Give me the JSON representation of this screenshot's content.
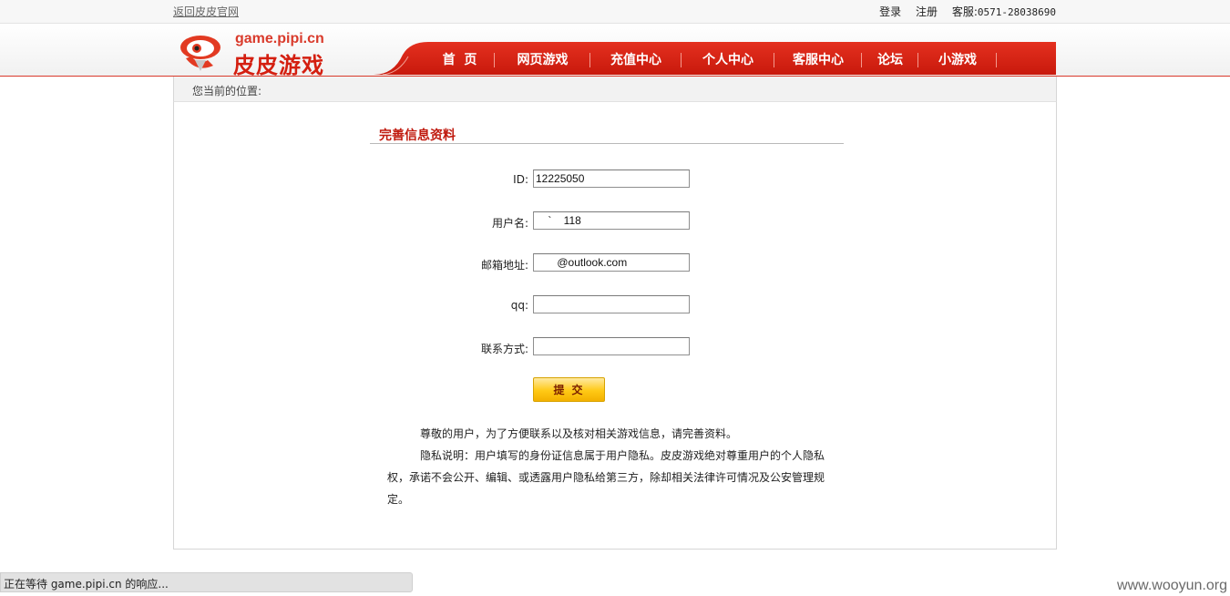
{
  "topbar": {
    "back_link": "返回皮皮官网",
    "login": "登录",
    "register": "注册",
    "service_label": "客服:",
    "service_phone": "0571-28038690"
  },
  "logo": {
    "domain": "game.pipi.cn",
    "brand": "皮皮游戏"
  },
  "nav": {
    "items": [
      {
        "label": "首  页"
      },
      {
        "label": "网页游戏"
      },
      {
        "label": "充值中心"
      },
      {
        "label": "个人中心"
      },
      {
        "label": "客服中心"
      },
      {
        "label": "论坛"
      },
      {
        "label": "小游戏"
      }
    ]
  },
  "breadcrumb": {
    "label": "您当前的位置:"
  },
  "form": {
    "title": "完善信息资料",
    "fields": [
      {
        "label": "ID:",
        "value": "12225050"
      },
      {
        "label": "用户名:",
        "value": "    `    118"
      },
      {
        "label": "邮箱地址:",
        "value": "       @outlook.com"
      },
      {
        "label": "qq:",
        "value": ""
      },
      {
        "label": "联系方式:",
        "value": ""
      }
    ],
    "submit_label": "提交"
  },
  "notes": {
    "line1": "尊敬的用户，为了方便联系以及核对相关游戏信息，请完善资料。",
    "line2": "隐私说明：用户填写的身份证信息属于用户隐私。皮皮游戏绝对尊重用户的个人隐私权，承诺不会公开、编辑、或透露用户隐私给第三方，除却相关法律许可情况及公安管理规定。"
  },
  "status_bar": {
    "text": "正在等待 game.pipi.cn 的响应..."
  },
  "watermark": "www.wooyun.org"
}
